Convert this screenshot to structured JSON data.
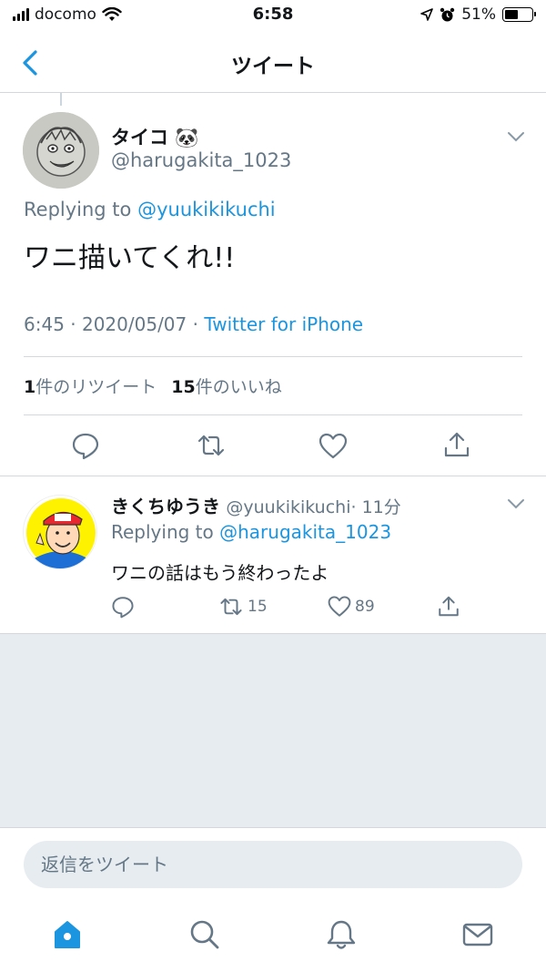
{
  "status_bar": {
    "carrier": "docomo",
    "time": "6:58",
    "battery": "51%",
    "battery_level": 0.51
  },
  "nav": {
    "title": "ツイート"
  },
  "main_tweet": {
    "name": "タイコ 🐼",
    "handle": "@harugakita_1023",
    "replying_prefix": "Replying to ",
    "replying_to": "@yuukikikuchi",
    "text": "ワニ描いてくれ!!",
    "time": "6:45 · 2020/05/07 · ",
    "source": "Twitter for iPhone",
    "retweet_count": "1",
    "retweet_label": "件のリツイート",
    "like_count": "15",
    "like_label": "件のいいね"
  },
  "reply": {
    "name": "きくちゆうき",
    "handle": "@yuukikikuchi",
    "age": "· 11分",
    "replying_prefix": "Replying to ",
    "replying_to": "@harugakita_1023",
    "text": "ワニの話はもう終わったよ",
    "retweets": "15",
    "likes": "89"
  },
  "composer": {
    "placeholder": "返信をツイート"
  },
  "colors": {
    "accent": "#1b95e0",
    "secondary_text": "#657786",
    "background_gray": "#e6ecf0"
  }
}
